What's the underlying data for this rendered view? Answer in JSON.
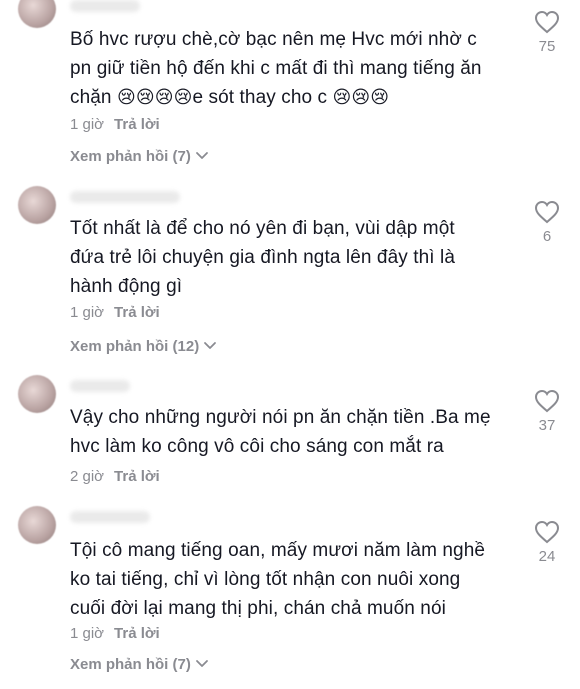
{
  "comments": [
    {
      "lines": [
        "Bố hvc rượu chè,cờ bạc nên mẹ Hvc mới nhờ c",
        "pn giữ tiền hộ đến khi c mất đi thì mang tiếng ăn"
      ],
      "last_line_a": "chặn ",
      "emoji_a": "😢😢😢😢",
      "last_line_b": "e sót thay cho c ",
      "emoji_b": "😢😢😢",
      "time": "1 giờ",
      "reply": "Trả lời",
      "likes": "75",
      "view_replies": "Xem phản hồi (7)"
    },
    {
      "lines": [
        "Tốt nhất là để cho nó yên đi bạn, vùi dập một",
        "đứa trẻ lôi chuyện gia đình ngta lên đây thì là",
        "hành động gì"
      ],
      "time": "1 giờ",
      "reply": "Trả lời",
      "likes": "6",
      "view_replies": "Xem phản hồi (12)"
    },
    {
      "lines": [
        "Vậy cho những người nói pn ăn chặn tiền .Ba mẹ",
        "hvc làm ko công vô côi cho sáng con mắt ra"
      ],
      "time": "2 giờ",
      "reply": "Trả lời",
      "likes": "37"
    },
    {
      "lines": [
        "Tội cô mang tiếng oan, mấy mươi năm làm nghề",
        "ko tai tiếng, chỉ vì lòng tốt nhận con nuôi xong",
        "cuối đời lại mang thị phi, chán chả muốn nói"
      ],
      "time": "1 giờ",
      "reply": "Trả lời",
      "likes": "24",
      "view_replies": "Xem phản hồi (7)"
    }
  ]
}
